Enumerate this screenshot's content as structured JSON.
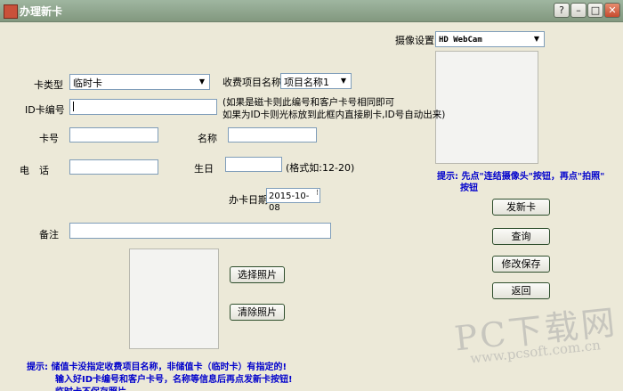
{
  "window": {
    "title": "办理新卡"
  },
  "camera": {
    "label": "摄像设置",
    "selected": "HD WebCam"
  },
  "card_type": {
    "label": "卡类型",
    "selected": "临时卡"
  },
  "fee_item": {
    "label": "收费项目名称",
    "selected": "项目名称1"
  },
  "id_card": {
    "label": "ID卡编号",
    "value": "",
    "hint_line1": "(如果是磁卡则此编号和客户卡号相同即可",
    "hint_line2": "如果为ID卡则光标放到此框内直接刷卡,ID号自动出来)"
  },
  "card_no": {
    "label": "卡号",
    "value": ""
  },
  "name": {
    "label": "名称",
    "value": ""
  },
  "phone": {
    "label": "电　话",
    "value": ""
  },
  "birthday": {
    "label": "生日",
    "value": "",
    "hint": "(格式如:12-20)"
  },
  "issue_date": {
    "label": "办卡日期",
    "value": "2015-10-08"
  },
  "remark": {
    "label": "备注",
    "value": ""
  },
  "camera_tip": {
    "line1": "提示: 先点\"连结摄像头\"按钮，再点\"拍照\"",
    "line2": "按钮"
  },
  "buttons": {
    "new_card": "发新卡",
    "query": "查询",
    "save": "修改保存",
    "back": "返回",
    "select_photo": "选择照片",
    "clear_photo": "清除照片"
  },
  "bottom_tip": {
    "line1": "提示: 储值卡没指定收费项目名称，非储值卡（临时卡）有指定的!",
    "line2": "输入好ID卡编号和客户卡号，名称等信息后再点发新卡按钮!",
    "line3": "临时卡不保存照片"
  },
  "watermark": {
    "main": "PC下载网",
    "url": "www.pcsoft.com.cn"
  }
}
